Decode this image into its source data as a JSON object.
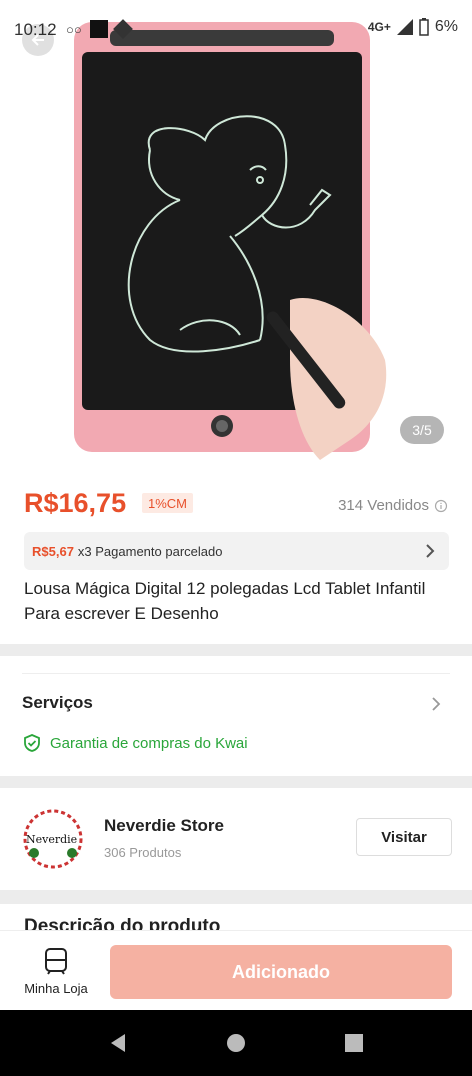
{
  "status_bar": {
    "time": "10:12",
    "network": "4G+",
    "battery": "6%"
  },
  "product_image": {
    "counter": "3/5"
  },
  "price": {
    "current": "R$16,75",
    "badge": "1%CM",
    "sold": "314 Vendidos"
  },
  "installment": {
    "amount": "R$5,67",
    "text": "x3 Pagamento parcelado"
  },
  "product_title": "Lousa Mágica Digital 12 polegadas Lcd Tablet Infantil Para escrever E Desenho",
  "services": {
    "title": "Serviços",
    "guarantee": "Garantia de compras do Kwai"
  },
  "store": {
    "name": "Neverdie Store",
    "products": "306 Produtos",
    "visit_label": "Visitar",
    "logo_text": "Neverdie"
  },
  "description": {
    "title": "Descrição do produto"
  },
  "bottom_bar": {
    "my_store_label": "Minha Loja",
    "add_label": "Adicionado"
  },
  "colors": {
    "accent": "#e8502b",
    "add_button": "#f5b1a2",
    "guarantee": "#2aa63a"
  }
}
